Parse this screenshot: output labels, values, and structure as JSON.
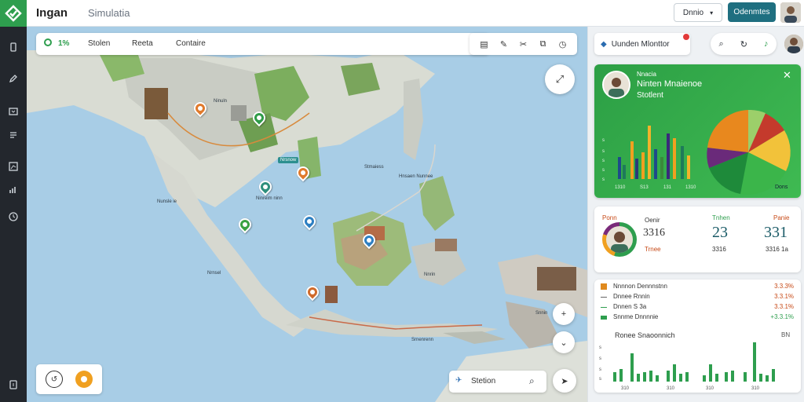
{
  "app": {
    "title": "Ingan",
    "subtitle": "Simulatia"
  },
  "topbar": {
    "select_label": "Dnnio",
    "cta_label": "Odenmtes"
  },
  "map": {
    "toolbar": {
      "badge_value": "1%",
      "tabs": [
        "Stolen",
        "Reeta",
        "Contaire"
      ]
    },
    "tool_icons": [
      "list-icon",
      "edit-icon",
      "scissors-icon",
      "layers-icon",
      "clock-icon"
    ],
    "search_label": "Stetion",
    "labels": [
      "Ninuln",
      "Nrsnow",
      "Ninreim ninn",
      "Nunsle ie",
      "Stmaiess",
      "Hnsaen Nunnee",
      "Nrnsel",
      "Nnrin",
      "Srnenrenn",
      "Snnin"
    ]
  },
  "panel": {
    "header_chip": "Uunden Mlonttor",
    "card": {
      "subtitle": "Nnacia",
      "title": "Ninten Mnaienoe",
      "name": "Stotlent",
      "bar_axis": [
        "s",
        "s",
        "s",
        "s",
        "s",
        "s"
      ],
      "bar_ticks": [
        "1310",
        "S13",
        "131",
        "1310"
      ],
      "pie_label": "Dons"
    },
    "stats": {
      "labels": [
        "Ponn",
        "Oenir",
        "Tnhen",
        "Panie"
      ],
      "left_value": "3316",
      "left_sub": "Trnee",
      "mid_value": "23",
      "mid_sub": "3316",
      "right_value": "331",
      "right_sub": "3316 1a"
    },
    "list": {
      "rows": [
        {
          "label": "Nnnnon Dennnstnn",
          "value": "3.3.3%"
        },
        {
          "label": "Dnnee Rnnin",
          "value": "3.3.1%"
        },
        {
          "label": "Dnnen S 3a",
          "value": "3.3.1%"
        },
        {
          "label": "Snnme Dnnnnie",
          "value": "+3.3.1%"
        }
      ],
      "chart_title": "Ronee Snaoonnich",
      "chart_right": "BN",
      "chart_ticks": [
        "310",
        "310",
        "310",
        "310"
      ]
    }
  },
  "colors": {
    "brand": "#2e9e4e",
    "cta": "#1f6f80",
    "water": "#a8cde6",
    "alert": "#c74a17"
  }
}
